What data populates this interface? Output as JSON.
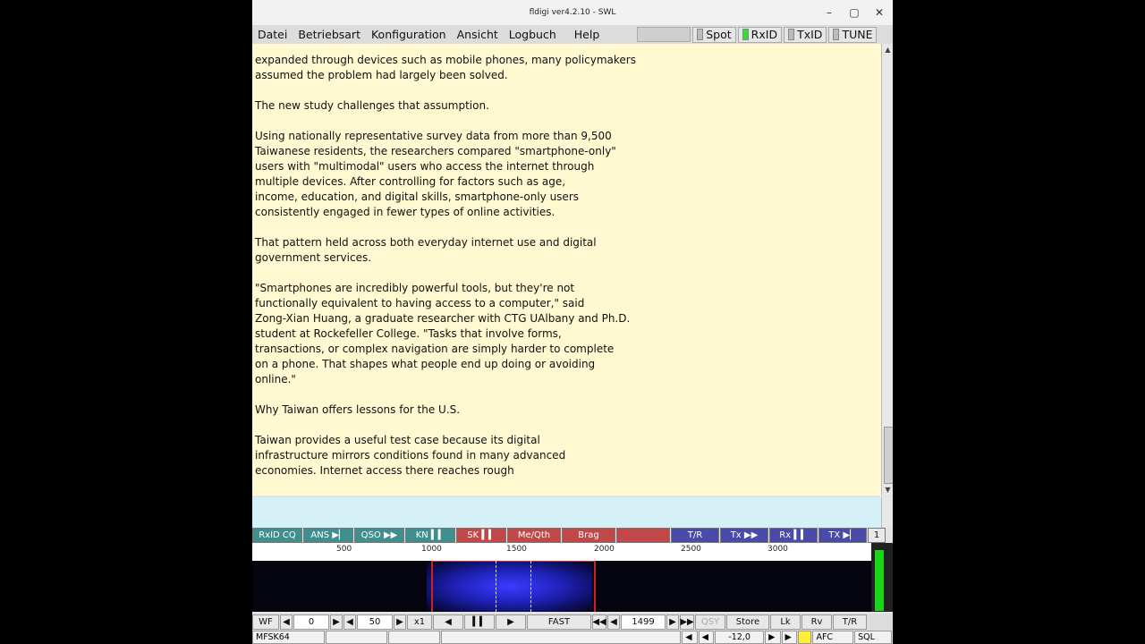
{
  "window": {
    "title": "fldigi ver4.2.10 - SWL"
  },
  "menu": {
    "items": [
      "Datei",
      "Betriebsart",
      "Konfiguration",
      "Ansicht",
      "Logbuch",
      "Help"
    ],
    "toggles": [
      {
        "label": "Spot",
        "on": false
      },
      {
        "label": "RxID",
        "on": true
      },
      {
        "label": "TxID",
        "on": false
      },
      {
        "label": "TUNE",
        "on": false
      }
    ]
  },
  "rx_text": "expanded through devices such as mobile phones, many policymakers\nassumed the problem had largely been solved.\n\nThe new study challenges that assumption.\n\nUsing nationally representative survey data from more than 9,500\nTaiwanese residents, the researchers compared \"smartphone-only\"\nusers with \"multimodal\" users who access the internet through\nmultiple devices. After controlling for factors such as age,\nincome, education, and digital skills, smartphone-only users\nconsistently engaged in fewer types of online activities.\n\nThat pattern held across both everyday internet use and digital\ngovernment services.\n\n\"Smartphones are incredibly powerful tools, but they're not\nfunctionally equivalent to having access to a computer,\" said\nZong-Xian Huang, a graduate researcher with CTG UAlbany and Ph.D.\nstudent at Rockefeller College. \"Tasks that involve forms,\ntransactions, or complex navigation are simply harder to complete\non a phone. That shapes what people end up doing or avoiding\nonline.\"\n\nWhy Taiwan offers lessons for the U.S.\n\nTaiwan provides a useful test case because its digital\ninfrastructure mirrors conditions found in many advanced\neconomies. Internet access there reaches rough",
  "macros": [
    {
      "label": "RxID CQ",
      "color": "#3f8f8f"
    },
    {
      "label": "ANS ▶▏",
      "color": "#3f8f8f"
    },
    {
      "label": "QSO ▶▶",
      "color": "#3f8f8f"
    },
    {
      "label": "KN ▍▍",
      "color": "#3f8f8f"
    },
    {
      "label": "SK ▍▍",
      "color": "#c04848"
    },
    {
      "label": "Me/Qth",
      "color": "#c04848"
    },
    {
      "label": "Brag",
      "color": "#c04848"
    },
    {
      "label": "",
      "color": "#c04848"
    },
    {
      "label": "T/R",
      "color": "#4a4aa8"
    },
    {
      "label": "Tx ▶▶",
      "color": "#4a4aa8"
    },
    {
      "label": "Rx ▍▍",
      "color": "#4a4aa8"
    },
    {
      "label": "TX ▶▏",
      "color": "#4a4aa8"
    },
    {
      "label": "1",
      "color": "#e8e8e8"
    }
  ],
  "scale": [
    "500",
    "1000",
    "1500",
    "2000",
    "2500",
    "3000"
  ],
  "controls": {
    "wf": "WF",
    "lower": "0",
    "range": "50",
    "zoom": "x1",
    "speed": "FAST",
    "freq": "1499",
    "qsy": "QSY",
    "store": "Store",
    "lk": "Lk",
    "rv": "Rv",
    "tr": "T/R"
  },
  "status": {
    "mode": "MFSK64",
    "squelch": "-12,0",
    "afc": "AFC",
    "sql": "SQL"
  }
}
